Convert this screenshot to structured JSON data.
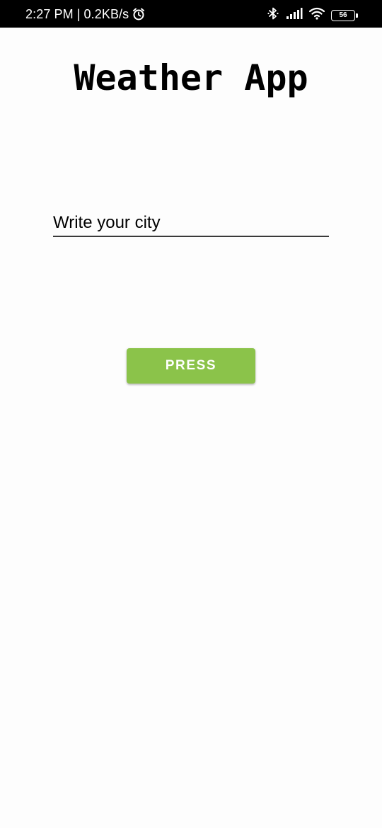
{
  "status_bar": {
    "time": "2:27 PM",
    "separator": "|",
    "network_speed": "0.2KB/s",
    "battery_level": "56",
    "icons": [
      "alarm-icon",
      "bluetooth-icon",
      "signal-icon",
      "wifi-icon",
      "battery-icon"
    ]
  },
  "app": {
    "title": "Weather App"
  },
  "city_input": {
    "placeholder": "Write your city",
    "value": ""
  },
  "press_button": {
    "label": "PRESS",
    "color": "#8bc34a"
  }
}
